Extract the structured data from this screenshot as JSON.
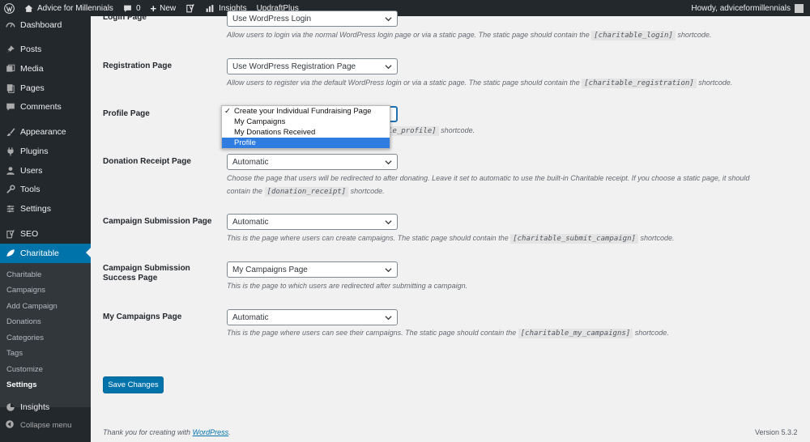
{
  "admin_bar": {
    "site_name": "Advice for Millennials",
    "comments_count": "0",
    "new_label": "New",
    "insights_label": "Insights",
    "updraft_label": "UpdraftPlus",
    "howdy": "Howdy, adviceformillennials"
  },
  "sidebar": {
    "dashboard": "Dashboard",
    "posts": "Posts",
    "media": "Media",
    "pages": "Pages",
    "comments": "Comments",
    "appearance": "Appearance",
    "plugins": "Plugins",
    "users": "Users",
    "tools": "Tools",
    "settings": "Settings",
    "seo": "SEO",
    "charitable": "Charitable",
    "submenu": [
      "Charitable",
      "Campaigns",
      "Add Campaign",
      "Donations",
      "Categories",
      "Tags",
      "Customize",
      "Settings"
    ],
    "insights": "Insights",
    "collapse": "Collapse menu",
    "active_color": "#0073aa"
  },
  "settings": {
    "login": {
      "label": "Login Page",
      "value": "Use WordPress Login",
      "desc_before": "Allow users to login via the normal WordPress login page or via a static page. The static page should contain the",
      "code": "[charitable_login]",
      "desc_after": "shortcode."
    },
    "registration": {
      "label": "Registration Page",
      "value": "Use WordPress Registration Page",
      "desc_before": "Allow users to register via the default WordPress login or via a static page. The static page should contain the",
      "code": "[charitable_registration]",
      "desc_after": "shortcode."
    },
    "profile": {
      "label": "Profile Page",
      "code": "[charitable_profile]",
      "code_visible": "le_profile]",
      "desc_after": "shortcode.",
      "options": [
        "Create your Individual Fundraising Page",
        "My Campaigns",
        "My Donations Received",
        "Profile"
      ],
      "checked_index": 0,
      "highlighted_index": 3
    },
    "donation_receipt": {
      "label": "Donation Receipt Page",
      "value": "Automatic",
      "desc_line1": "Choose the page that users will be redirected to after donating. Leave it set to automatic to use the built-in Charitable receipt. If you choose a static page, it should",
      "desc_line2_before": "contain the",
      "code": "[donation_receipt]",
      "desc_after": "shortcode."
    },
    "campaign_submission": {
      "label": "Campaign Submission Page",
      "value": "Automatic",
      "desc_before": "This is the page where users can create campaigns. The static page should contain the",
      "code": "[charitable_submit_campaign]",
      "desc_after": "shortcode."
    },
    "campaign_success": {
      "label_line1": "Campaign Submission",
      "label_line2": "Success Page",
      "value": "My Campaigns Page",
      "desc": "This is the page to which users are redirected after submitting a campaign."
    },
    "my_campaigns": {
      "label": "My Campaigns Page",
      "value": "Automatic",
      "desc_before": "This is the page where users can see their campaigns. The static page should contain the",
      "code": "[charitable_my_campaigns]",
      "desc_after": "shortcode."
    }
  },
  "save_label": "Save Changes",
  "footer": {
    "thanks_before": "Thank you for creating with",
    "wordpress_link": "WordPress",
    "thanks_after": ".",
    "version": "Version 5.3.2"
  }
}
